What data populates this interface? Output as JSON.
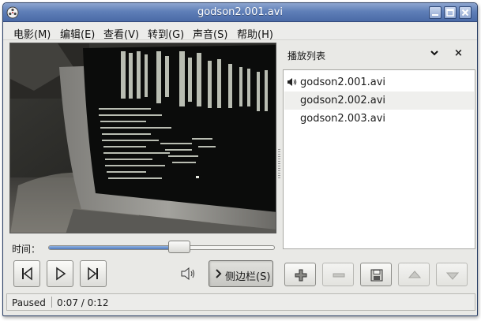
{
  "window": {
    "title": "godson2.001.avi"
  },
  "menu": [
    {
      "label": "电影(M)"
    },
    {
      "label": "编辑(E)"
    },
    {
      "label": "查看(V)"
    },
    {
      "label": "转到(G)"
    },
    {
      "label": "声音(S)"
    },
    {
      "label": "帮助(H)"
    }
  ],
  "seek": {
    "label": "时间：",
    "progress": 0.58
  },
  "controls": {
    "sidebar_label": "侧边栏(S)"
  },
  "playlist": {
    "title": "播放列表",
    "items": [
      {
        "name": "godson2.001.avi",
        "playing": true
      },
      {
        "name": "godson2.002.avi",
        "playing": false
      },
      {
        "name": "godson2.003.avi",
        "playing": false
      }
    ]
  },
  "status": {
    "state": "Paused",
    "time": "0:07 / 0:12"
  },
  "colors": {
    "titlebar": "#5f7fb8",
    "seek_fill": "#4f79bd",
    "video_bg": "#1d1d1c",
    "screen_text": "#d8ddd0"
  }
}
